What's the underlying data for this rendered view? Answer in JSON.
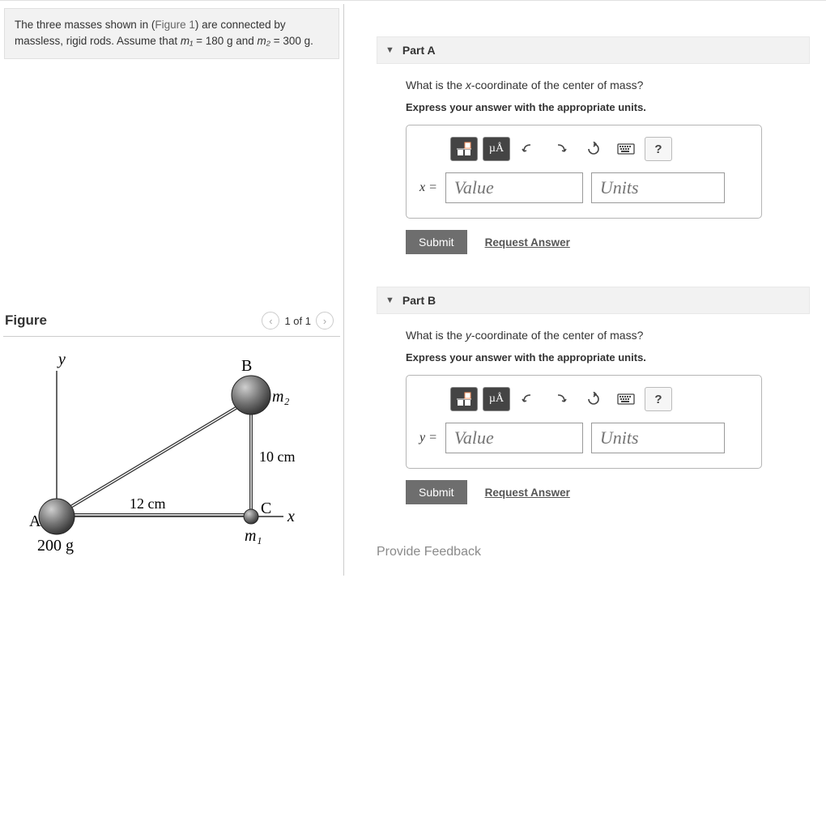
{
  "problem": {
    "pre_text": "The three masses shown in (",
    "figure_link": "Figure 1",
    "post_text": ") are connected by massless, rigid rods. Assume that ",
    "m1_sym": "m₁",
    "m1_assign": " = 180 g and ",
    "m2_sym": "m₂",
    "m2_assign": " = 300 g."
  },
  "figure": {
    "title": "Figure",
    "counter": "1 of 1",
    "labels": {
      "y": "y",
      "x": "x",
      "A": "A",
      "B": "B",
      "C": "C",
      "m1": "m₁",
      "m2": "m₂",
      "massA": "200 g",
      "len_ac": "12 cm",
      "len_bc": "10 cm"
    }
  },
  "partA": {
    "title": "Part A",
    "question": "What is the x-coordinate of the center of mass?",
    "question_var": "x",
    "instruction": "Express your answer with the appropriate units.",
    "var_label": "x =",
    "value_ph": "Value",
    "units_ph": "Units",
    "units_btn": "µÅ",
    "help": "?",
    "submit": "Submit",
    "request": "Request Answer"
  },
  "partB": {
    "title": "Part B",
    "question": "What is the y-coordinate of the center of mass?",
    "question_var": "y",
    "instruction": "Express your answer with the appropriate units.",
    "var_label": "y =",
    "value_ph": "Value",
    "units_ph": "Units",
    "units_btn": "µÅ",
    "help": "?",
    "submit": "Submit",
    "request": "Request Answer"
  },
  "feedback": "Provide Feedback"
}
